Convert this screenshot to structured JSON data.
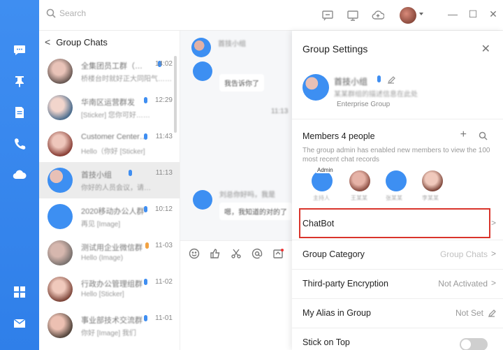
{
  "search": {
    "placeholder": "Search"
  },
  "window": {
    "minimize": "—",
    "maximize": "☐",
    "close": "✕"
  },
  "list": {
    "back": "<",
    "title": "Group Chats",
    "chats": [
      {
        "name": "全集团员工群（…",
        "preview": "桥楼台时就好正大同阳气……",
        "time": "14:02",
        "selected": false
      },
      {
        "name": "华南区运营群发",
        "preview": "[Sticker] 您你可好……",
        "time": "12:29",
        "selected": false
      },
      {
        "name": "Customer Center…",
        "preview": "Hello（你好 [Sticker]",
        "time": "11:43",
        "selected": false
      },
      {
        "name": "首技小组",
        "preview": "你好的人员会议，请…",
        "time": "11:13",
        "selected": true
      },
      {
        "name": "2020移动办公人群",
        "preview": "再见 [Image]",
        "time": "10:12",
        "selected": false
      },
      {
        "name": "测试用企业微信群",
        "preview": "Hello (Image)",
        "time": "11-03",
        "selected": false
      },
      {
        "name": "行政办公管理组群",
        "preview": "Hello [Sticker]",
        "time": "11-02",
        "selected": false
      },
      {
        "name": "事业部技术交流群",
        "preview": "你好 [Image] 我们",
        "time": "11-01",
        "selected": false
      }
    ]
  },
  "conversation": {
    "sender": "首技小组",
    "msg1": "我告诉你了",
    "time_divider": "11:13",
    "sender2": "刘总你好吗，我是",
    "msg2": "嗯，我知道的对的了"
  },
  "settings": {
    "title": "Group Settings",
    "close": "✕",
    "group_name": "首技小组",
    "group_desc": "某某群组的描述信息在此处",
    "group_type": "Enterprise Group",
    "members_title": "Members 4 people",
    "add": "+",
    "notice": "The group admin has enabled new members to view the 100 most recent chat records",
    "admin_tag": "Admin",
    "members": [
      {
        "label": "主持人"
      },
      {
        "label": "王某某"
      },
      {
        "label": "张某某"
      },
      {
        "label": "李某某"
      }
    ],
    "chatbot": "ChatBot",
    "group_category": "Group Category",
    "group_category_value": "Group Chats",
    "encryption": "Third-party Encryption",
    "encryption_value": "Not Activated",
    "alias": "My Alias in Group",
    "alias_value": "Not Set",
    "stick_on_top": "Stick on Top",
    "chevron": ">"
  },
  "colors": {
    "accent": "#3f8ef1",
    "highlight": "#d9342b"
  }
}
